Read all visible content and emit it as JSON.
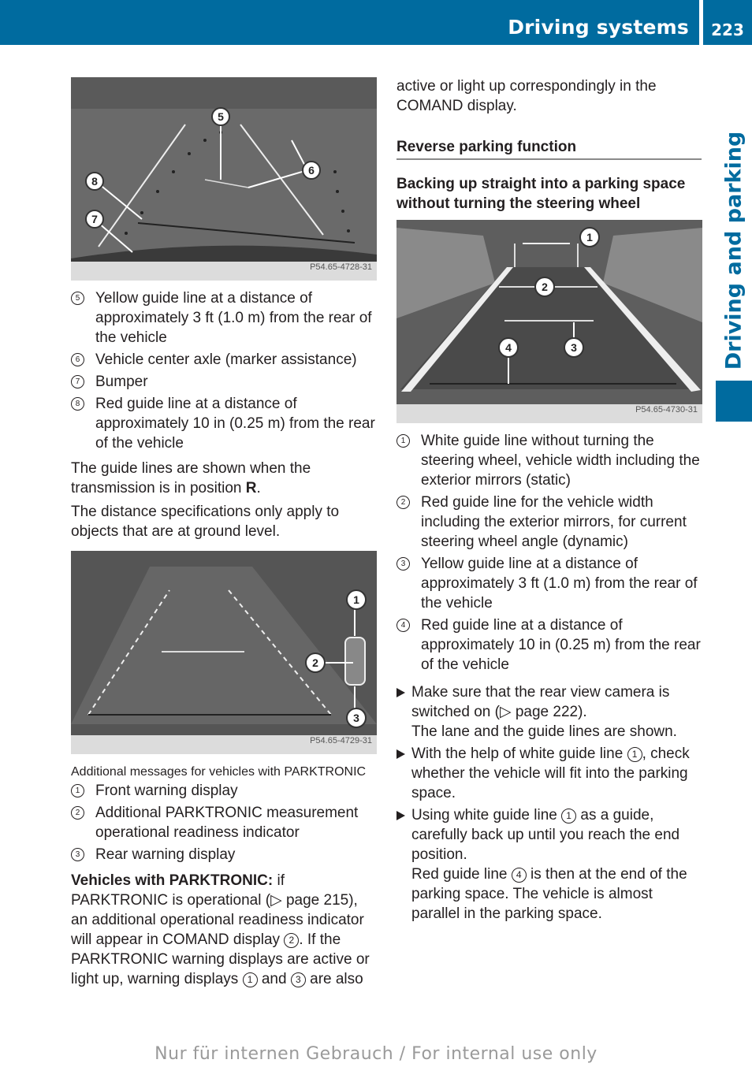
{
  "header": {
    "section_title": "Driving systems",
    "page_number": "223",
    "accent_color": "#006b9f"
  },
  "side_tab": {
    "label": "Driving and parking"
  },
  "left": {
    "figure1": {
      "code": "P54.65-4728-31",
      "callouts": [
        "5",
        "6",
        "7",
        "8"
      ]
    },
    "legend1": [
      {
        "num": "5",
        "text": "Yellow guide line at a distance of approximately 3 ft (1.0 m) from the rear of the vehicle"
      },
      {
        "num": "6",
        "text": "Vehicle center axle (marker assistance)"
      },
      {
        "num": "7",
        "text": "Bumper"
      },
      {
        "num": "8",
        "text": "Red guide line at a distance of approximately 10 in (0.25 m) from the rear of the vehicle"
      }
    ],
    "para1_a": "The guide lines are shown when the transmission is in position ",
    "para1_bold": "R",
    "para1_b": ".",
    "para2": "The distance specifications only apply to objects that are at ground level.",
    "figure2": {
      "code": "P54.65-4729-31",
      "callouts": [
        "1",
        "2",
        "3"
      ]
    },
    "caption2": "Additional messages for vehicles with PARKTRONIC",
    "legend2": [
      {
        "num": "1",
        "text": "Front warning display"
      },
      {
        "num": "2",
        "text": "Additional PARKTRONIC measurement operational readiness indicator"
      },
      {
        "num": "3",
        "text": "Rear warning display"
      }
    ],
    "parktronic": {
      "bold": "Vehicles with PARKTRONIC:",
      "t1": " if PARKTRONIC is operational (",
      "ref_icon": "▷",
      "t2": " page 215), an additional operational readiness indicator will appear in COMAND display ",
      "n1": "2",
      "t3": ". If the PARKTRONIC warning displays are active or light up, warning displays ",
      "n2": "1",
      "t4": " and ",
      "n3": "3",
      "t5": " are also"
    }
  },
  "right": {
    "cont": "active or light up correspondingly in the COMAND display.",
    "heading": "Reverse parking function",
    "subheading": "Backing up straight into a parking space without turning the steering wheel",
    "figure3": {
      "code": "P54.65-4730-31",
      "callouts": [
        "1",
        "2",
        "3",
        "4"
      ]
    },
    "legend3": [
      {
        "num": "1",
        "text": "White guide line without turning the steering wheel, vehicle width including the exterior mirrors (static)"
      },
      {
        "num": "2",
        "text": "Red guide line for the vehicle width including the exterior mirrors, for current steering wheel angle (dynamic)"
      },
      {
        "num": "3",
        "text": "Yellow guide line at a distance of approximately 3 ft (1.0 m) from the rear of the vehicle"
      },
      {
        "num": "4",
        "text": "Red guide line at a distance of approximately 10 in (0.25 m) from the rear of the vehicle"
      }
    ],
    "steps": [
      {
        "a": "Make sure that the rear view camera is switched on (",
        "icon": "▷",
        "b": " page 222).",
        "result": "The lane and the guide lines are shown."
      },
      {
        "a": "With the help of white guide line ",
        "n": "1",
        "b": ", check whether the vehicle will fit into the parking space."
      },
      {
        "a": "Using white guide line ",
        "n": "1",
        "b": " as a guide, carefully back up until you reach the end position.",
        "r1": "Red guide line ",
        "rn": "4",
        "r2": " is then at the end of the parking space. The vehicle is almost parallel in the parking space."
      }
    ]
  },
  "footer": "Nur für internen Gebrauch / For internal use only"
}
